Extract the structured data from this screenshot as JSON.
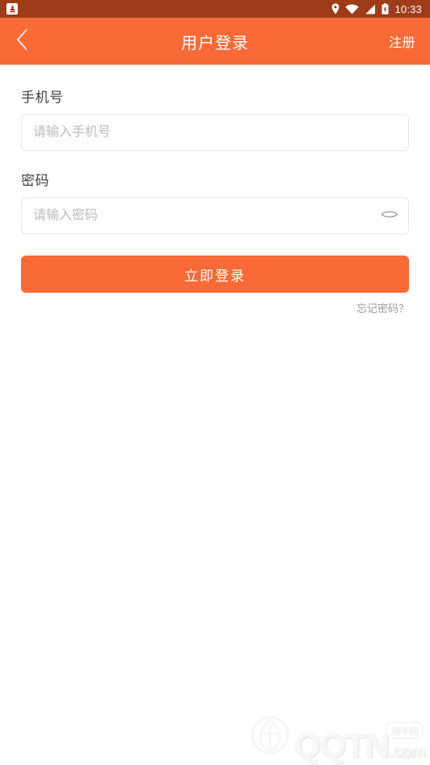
{
  "statusbar": {
    "app_icon": "app-notification-icon",
    "icons": [
      "location-pin-icon",
      "wifi-icon",
      "cellular-signal-icon",
      "battery-icon"
    ],
    "time": "10:33",
    "background_color": "#9E3B19"
  },
  "appbar": {
    "back_icon": "chevron-left-icon",
    "title": "用户登录",
    "register_label": "注册",
    "background_color": "#F96A36"
  },
  "form": {
    "phone": {
      "label": "手机号",
      "value": "",
      "placeholder": "请输入手机号"
    },
    "password": {
      "label": "密码",
      "value": "",
      "placeholder": "请输入密码",
      "toggle_icon": "eye-closed-icon"
    },
    "submit_label": "立即登录",
    "forgot_label": "忘记密码？",
    "accent_color": "#F96A36"
  },
  "watermark": {
    "logo_icon": "qqtn-logo-icon",
    "brand": "QQTN",
    "domain": ".com",
    "badge": "腾牛网"
  }
}
